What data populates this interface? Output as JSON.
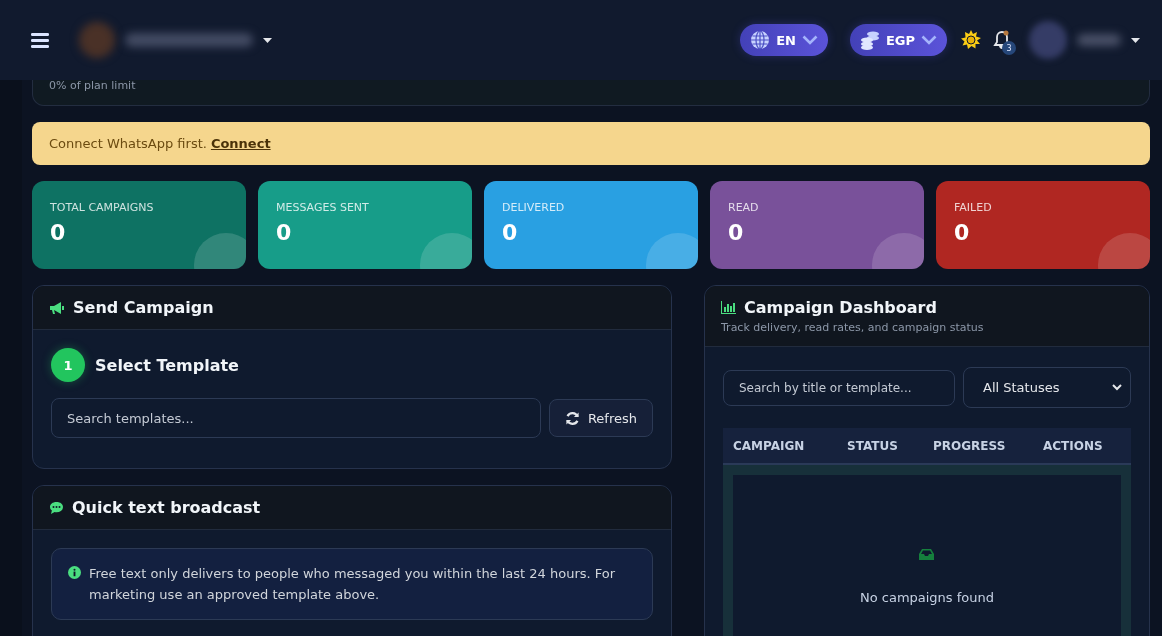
{
  "header": {
    "language": "EN",
    "currency": "EGP",
    "notifications": "3"
  },
  "plan_usage": {
    "text": "0% of plan limit"
  },
  "alert": {
    "text": "Connect WhatsApp first.",
    "link": "Connect"
  },
  "stats": [
    {
      "label": "TOTAL CAMPAIGNS",
      "value": "0",
      "color": "#0e7263"
    },
    {
      "label": "MESSAGES SENT",
      "value": "0",
      "color": "#179d89"
    },
    {
      "label": "DELIVERED",
      "value": "0",
      "color": "#29a0e2"
    },
    {
      "label": "READ",
      "value": "0",
      "color": "#79519a"
    },
    {
      "label": "FAILED",
      "value": "0",
      "color": "#b02722"
    }
  ],
  "send_campaign": {
    "title": "Send Campaign",
    "step": {
      "number": "1",
      "title": "Select Template"
    },
    "search": {
      "placeholder": "Search templates..."
    },
    "refresh_button": "Refresh"
  },
  "quick_broadcast": {
    "title": "Quick text broadcast",
    "info": "Free text only delivers to people who messaged you within the last 24 hours. For marketing use an approved template above."
  },
  "dashboard": {
    "title": "Campaign Dashboard",
    "subtitle": "Track delivery, read rates, and campaign status",
    "search": {
      "placeholder": "Search by title or template..."
    },
    "status_filter": "All Statuses",
    "columns": [
      "CAMPAIGN",
      "STATUS",
      "PROGRESS",
      "ACTIONS"
    ],
    "empty_text": "No campaigns found"
  }
}
